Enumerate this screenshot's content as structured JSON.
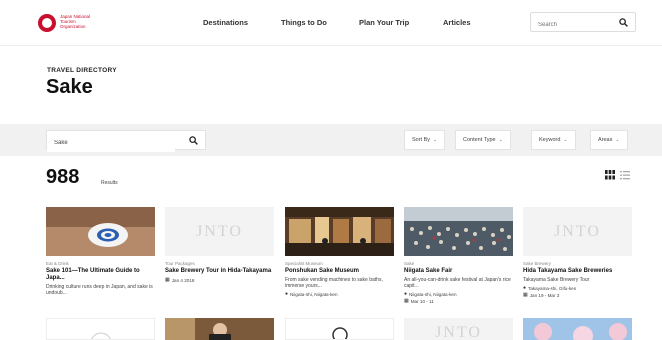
{
  "header": {
    "logo_text": "Japan National Tourism Organization",
    "nav": [
      "Destinations",
      "Things to Do",
      "Plan Your Trip",
      "Articles"
    ],
    "search_placeholder": "Search"
  },
  "page": {
    "eyebrow": "TRAVEL DIRECTORY",
    "title": "Sake"
  },
  "filters": {
    "search_value": "Sake",
    "buttons": [
      "Sort By",
      "Content Type",
      "Keyword",
      "Areas"
    ]
  },
  "results": {
    "count": "988",
    "label": "Results"
  },
  "cards": [
    {
      "category": "Eat & Drink",
      "title": "Sake 101—The Ultimate Guide to Japa...",
      "desc": "Drinking culture runs deep in Japan, and sake is undoub...",
      "location": "",
      "date": "",
      "thumb": "sake-cup"
    },
    {
      "category": "Tour Packages",
      "title": "Sake Brewery Tour in Hida-Takayama",
      "desc": "",
      "location": "",
      "date": "Jan 4 2018",
      "thumb": "jnto"
    },
    {
      "category": "Specialist Museum",
      "title": "Ponshukan Sake Museum",
      "desc": "From sake vending machines to sake baths, immerse yours...",
      "location": "Niigata-shi, Niigata-ken",
      "date": "",
      "thumb": "museum"
    },
    {
      "category": "Sake",
      "title": "Niigata Sake Fair",
      "desc": "An all-you-can-drink sake festival at Japan's rice capit...",
      "location": "Niigata-shi, Niigata-ken",
      "date": "Mar 10 - 11",
      "thumb": "crowd"
    },
    {
      "category": "Sake Brewery",
      "title": "Hida Takayama Sake Breweries",
      "desc": "Takayama Sake Brewery Tour",
      "location": "Takayama-shi, Gifu-ken",
      "date": "Jan 19 - Mar 3",
      "thumb": "jnto"
    }
  ],
  "thumb_text": "JNTO",
  "row2_text": "JNTO",
  "colors": {
    "brand_red": "#c8102e",
    "filter_bg": "#f1f1f1"
  }
}
